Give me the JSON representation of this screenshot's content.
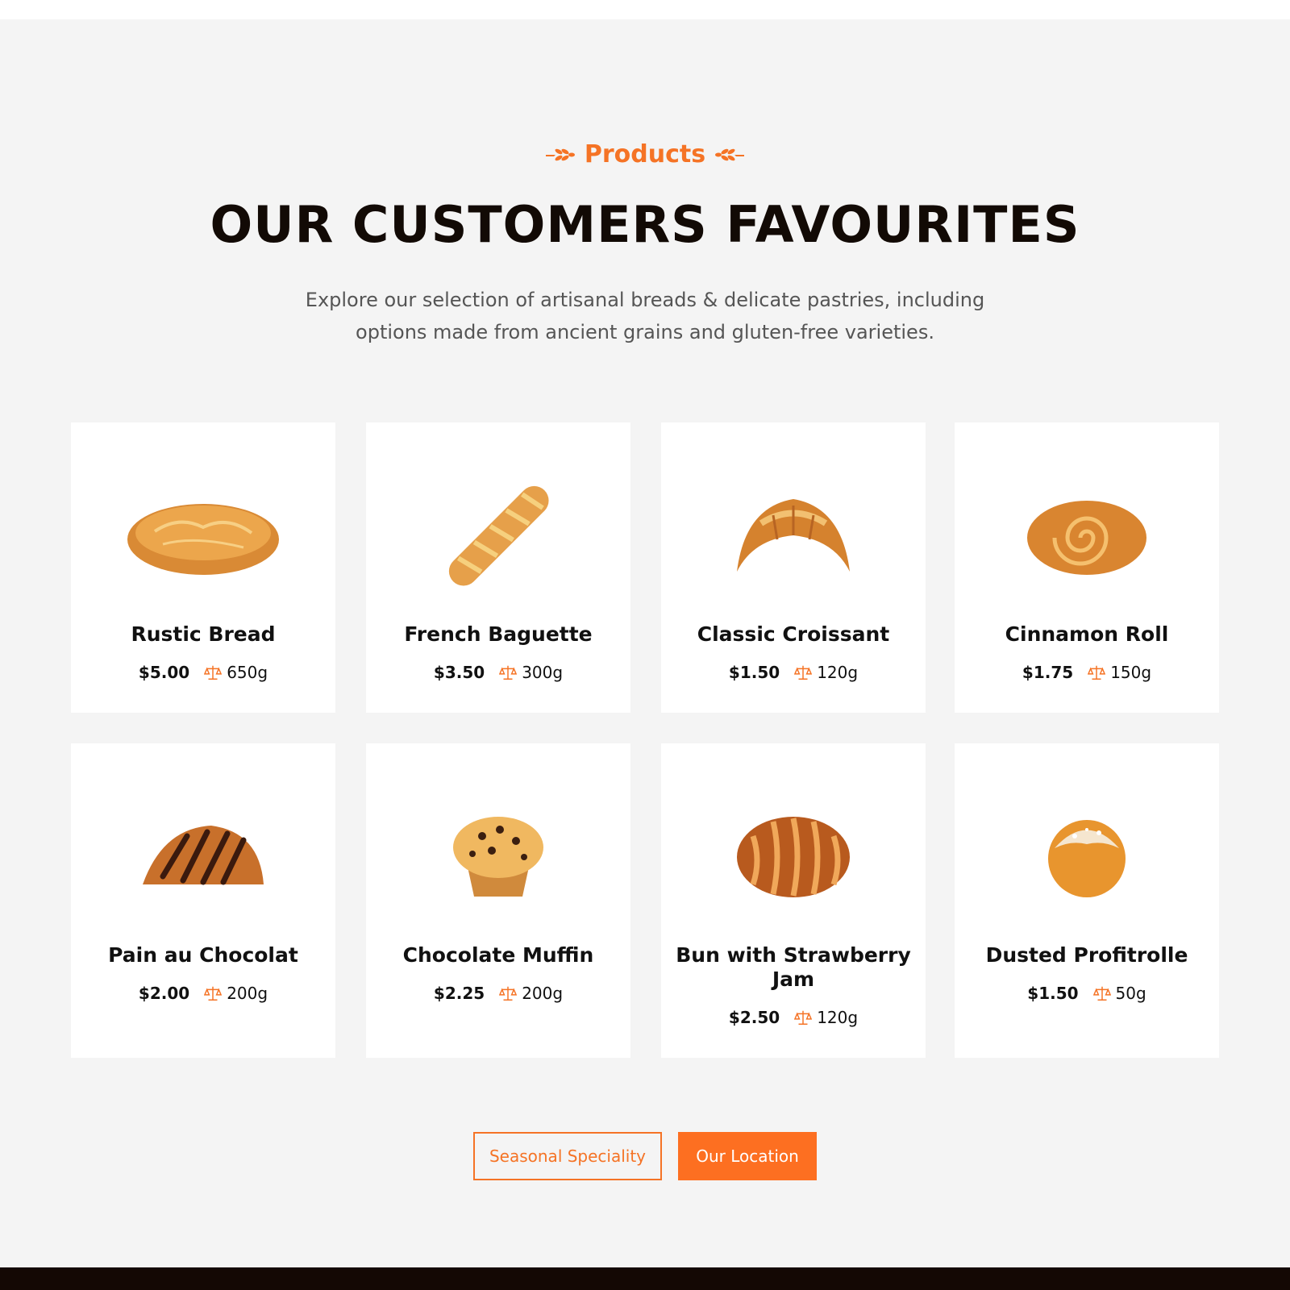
{
  "section": {
    "eyebrow": "Products",
    "title": "OUR CUSTOMERS FAVOURITES",
    "intro": "Explore our selection of artisanal breads & delicate pastries, including options made from ancient grains and gluten-free varieties."
  },
  "products": [
    {
      "name": "Rustic Bread",
      "price": "$5.00",
      "weight": "650g",
      "icon": "rustic-bread-image"
    },
    {
      "name": "French Baguette",
      "price": "$3.50",
      "weight": "300g",
      "icon": "baguette-image"
    },
    {
      "name": "Classic Croissant",
      "price": "$1.50",
      "weight": "120g",
      "icon": "croissant-image"
    },
    {
      "name": "Cinnamon Roll",
      "price": "$1.75",
      "weight": "150g",
      "icon": "cinnamon-roll-image"
    },
    {
      "name": "Pain au Chocolat",
      "price": "$2.00",
      "weight": "200g",
      "icon": "pain-au-chocolat-image"
    },
    {
      "name": "Chocolate Muffin",
      "price": "$2.25",
      "weight": "200g",
      "icon": "muffin-image"
    },
    {
      "name": "Bun with Strawberry Jam",
      "price": "$2.50",
      "weight": "120g",
      "icon": "strawberry-bun-image"
    },
    {
      "name": "Dusted Profitrolle",
      "price": "$1.50",
      "weight": "50g",
      "icon": "profitrolle-image"
    }
  ],
  "buttons": {
    "seasonal": "Seasonal Speciality",
    "location": "Our Location"
  },
  "colors": {
    "accent": "#f57325",
    "background": "#f4f4f4",
    "footer": "#140804",
    "headline": "#120a05"
  }
}
